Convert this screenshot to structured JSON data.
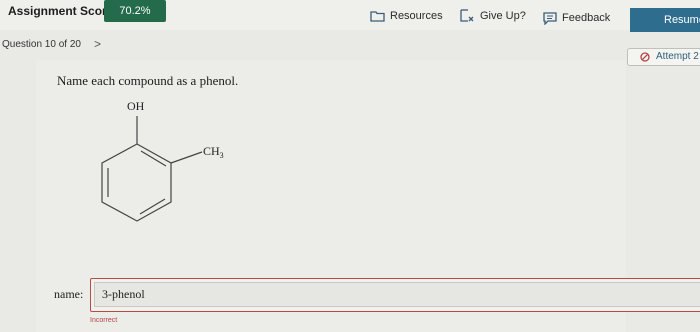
{
  "header": {
    "score_label": "Assignment Score:",
    "score_value": "70.2%",
    "resources_label": "Resources",
    "give_up_label": "Give Up?",
    "feedback_label": "Feedback",
    "resume_label": "Resume"
  },
  "nav": {
    "question_label": "Question 10 of 20",
    "next_chevron": ">",
    "attempt_label": "Attempt 2"
  },
  "question": {
    "prompt": "Name each compound as a phenol.",
    "oh_label": "OH",
    "ch3_label": "CH",
    "ch3_subscript": "3"
  },
  "answer": {
    "name_label": "name:",
    "value": "3-phenol",
    "status": "Incorrect"
  },
  "colors": {
    "score_bg": "#236b4a",
    "resume_bg": "#2f6d8f",
    "error": "#b54444"
  }
}
